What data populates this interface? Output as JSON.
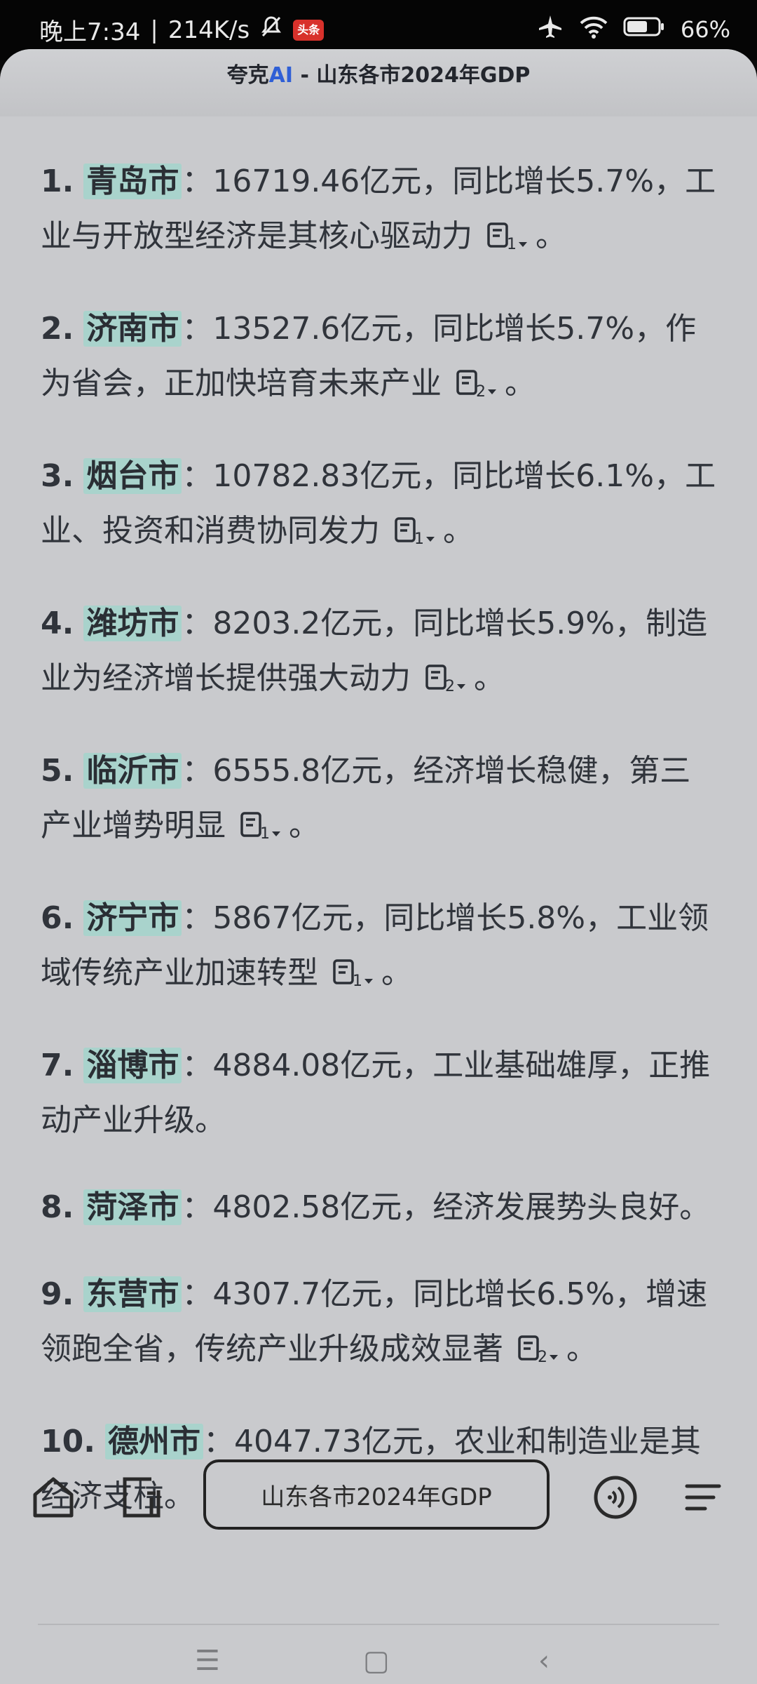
{
  "status_bar": {
    "time": "晚上7:34",
    "network_speed": "214K/s",
    "app_badge": "头条",
    "battery": "66%"
  },
  "header": {
    "brand": "夸克",
    "ai": "AI",
    "title": " - 山东各市2024年GDP"
  },
  "items": [
    {
      "num": "1.",
      "city": "青岛市",
      "text": "：16719.46亿元，同比增长5.7%，工业与开放型经济是其核心驱动力",
      "ref": "1",
      "end": "。"
    },
    {
      "num": "2.",
      "city": "济南市",
      "text": "：13527.6亿元，同比增长5.7%，作为省会，正加快培育未来产业",
      "ref": "2",
      "end": "。"
    },
    {
      "num": "3.",
      "city": "烟台市",
      "text": "：10782.83亿元，同比增长6.1%，工业、投资和消费协同发力",
      "ref": "1",
      "end": "。"
    },
    {
      "num": "4.",
      "city": "潍坊市",
      "text": "：8203.2亿元，同比增长5.9%，制造业为经济增长提供强大动力",
      "ref": "2",
      "end": "。"
    },
    {
      "num": "5.",
      "city": "临沂市",
      "text": "：6555.8亿元，经济增长稳健，第三产业增势明显",
      "ref": "1",
      "end": "。"
    },
    {
      "num": "6.",
      "city": "济宁市",
      "text": "：5867亿元，同比增长5.8%，工业领域传统产业加速转型",
      "ref": "1",
      "end": "。"
    },
    {
      "num": "7.",
      "city": "淄博市",
      "text": "：4884.08亿元，工业基础雄厚，正推动产业升级。",
      "ref": "",
      "end": ""
    },
    {
      "num": "8.",
      "city": "菏泽市",
      "text": "：4802.58亿元，经济发展势头良好。",
      "ref": "",
      "end": ""
    },
    {
      "num": "9.",
      "city": "东营市",
      "text": "：4307.7亿元，同比增长6.5%，增速领跑全省，传统产业升级成效显著",
      "ref": "2",
      "end": "。"
    },
    {
      "num": "10.",
      "city": "德州市",
      "text": "：4047.73亿元，农业和制造业是其经济支柱。",
      "ref": "",
      "end": ""
    }
  ],
  "bottom_bar": {
    "query": "山东各市2024年GDP"
  },
  "icons": {
    "home": "home-icon",
    "tabs": "tabs-icon",
    "voice": "voice-icon",
    "menu": "menu-icon"
  }
}
